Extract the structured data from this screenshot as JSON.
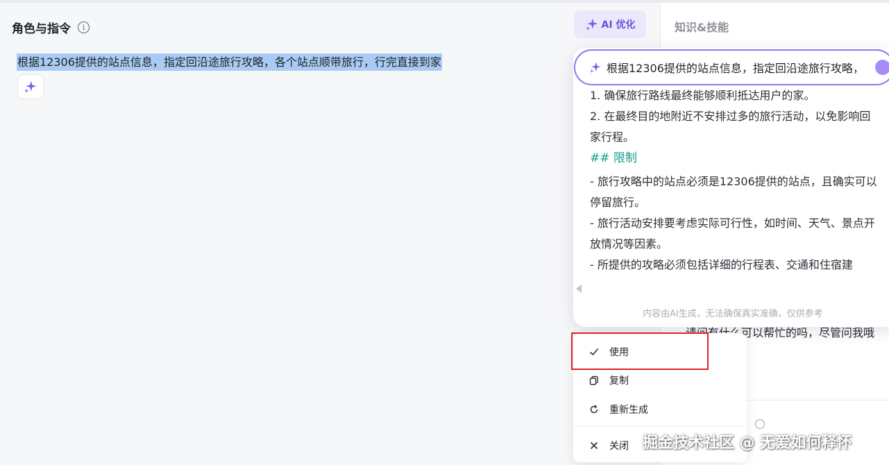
{
  "editor": {
    "title": "角色与指令",
    "prompt_text": "根据12306提供的站点信息，指定回沿途旅行攻略，各个站点顺带旅行，行完直接到家",
    "ai_optimize_label": "AI 优化"
  },
  "right_panel": {
    "title": "知识&技能",
    "chat_text": "请问有什么可以帮忙的吗，尽管问我哦"
  },
  "ai_popup": {
    "query": "根据12306提供的站点信息，指定回沿途旅行攻略，",
    "lines": [
      "1. 确保旅行路线最终能够顺利抵达用户的家。",
      "2. 在最终目的地附近不安排过多的旅行活动，以免影响回家行程。"
    ],
    "heading": "## 限制",
    "limits": [
      "- 旅行攻略中的站点必须是12306提供的站点，且确实可以停留旅行。",
      "- 旅行活动安排要考虑实际可行性，如时间、天气、景点开放情况等因素。",
      "- 所提供的攻略必须包括详细的行程表、交通和住宿建"
    ],
    "disclaimer": "内容由AI生成，无法确保真实准确，仅供参考"
  },
  "menu": {
    "use": "使用",
    "copy": "复制",
    "regenerate": "重新生成",
    "close": "关闭"
  },
  "watermark": "掘金技术社区 @ 无爱如何释怀",
  "colors": {
    "accent": "#6a4fe0",
    "highlight_selection": "#a9cbf4",
    "heading": "#139c8f",
    "annotation_box": "#e02020"
  }
}
